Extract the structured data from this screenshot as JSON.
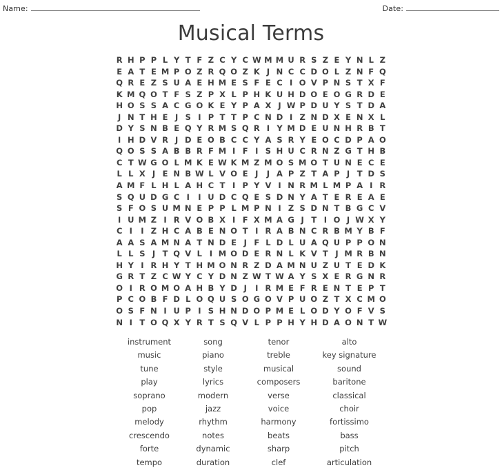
{
  "header": {
    "name_label": "Name:",
    "date_label": "Date:"
  },
  "title": "Musical Terms",
  "puzzle": {
    "rows": 22,
    "cols": 24,
    "grid": [
      "RHPPLYTFZCYCWMMURSZEYNLZ",
      "EATEMPOZRQOZKJNCCDOLZNFQ",
      "QREZSUAEHMESFECIOVPNSTXF",
      "KMQOTFSZPXLPHKUHDOEOGRDE",
      "HOSSACGOKEYPAXJWPDUYSTDA",
      "JNTHEJSIPTTPCNDIZNDXENXL",
      "DYSNBEQYRMSQRIYMDEUNHRBT",
      "IHDVRJDEOBCCYASRYEOCDPAO",
      "QOSSABBRFMIFISHUCRNZGTHB",
      "CTWGOLMKEWKMZMOSMOTUNECE",
      "LLXJENBWLVOEJJAPZTAPJTDS",
      "AMFLHLAHCTIPYVINRMLMPAIR",
      "SQUDGCIIUDCQESDNYATEREAE",
      "SFOSUMNEPPLMPNIZSDNTBGCV",
      "IUMZIRVOBXIFXMAGJTIOJWXY",
      "CIIZHCABENOTIRABNCRBMYBF",
      "AASAMNATNDEJFLDLUAQUPPON",
      "LLSJTQVLIMODERNLKVTJMRBN",
      "HYIRHYTHMONRZDAMNUZUTEDK",
      "GRTZCWYCYDNZWTWAYSXERGNR",
      "OIROMOAHBYDJIRMEFRENTEPT",
      "PCOBFDLOQUSOGOVPUOZTXCMO",
      "OSFNIUPISHNDOPMELODYOFVS",
      "NITOQXYRTSQVLPPHYHDAONTW"
    ]
  },
  "wordlist": {
    "rows": [
      [
        "instrument",
        "song",
        "tenor",
        "alto"
      ],
      [
        "music",
        "piano",
        "treble",
        "key signature"
      ],
      [
        "tune",
        "style",
        "musical",
        "sound"
      ],
      [
        "play",
        "lyrics",
        "composers",
        "baritone"
      ],
      [
        "soprano",
        "modern",
        "verse",
        "classical"
      ],
      [
        "pop",
        "jazz",
        "voice",
        "choir"
      ],
      [
        "melody",
        "rhythm",
        "harmony",
        "fortissimo"
      ],
      [
        "crescendo",
        "notes",
        "beats",
        "bass"
      ],
      [
        "forte",
        "dynamic",
        "sharp",
        "pitch"
      ],
      [
        "tempo",
        "duration",
        "clef",
        "articulation"
      ]
    ]
  },
  "colors": {
    "text": "#3d3d3d",
    "rule": "#777777",
    "background": "#ffffff"
  }
}
